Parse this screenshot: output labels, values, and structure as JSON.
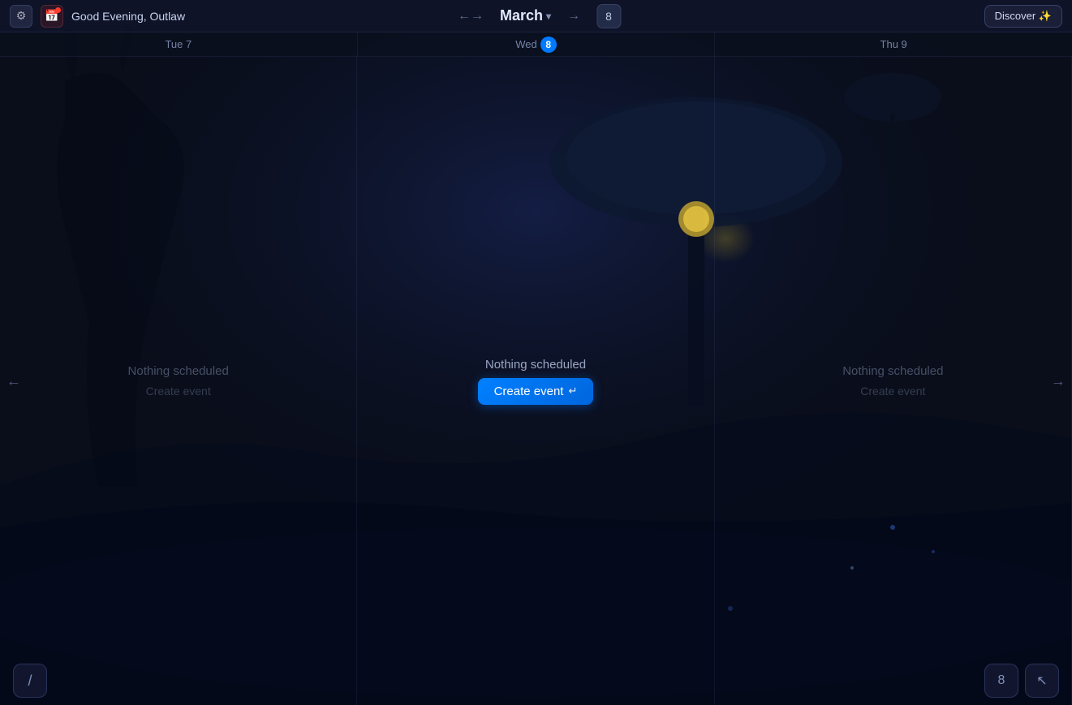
{
  "header": {
    "greeting": "Good Evening, Outlaw",
    "month": "March",
    "chevron": "▾",
    "day_number": "8",
    "discover_label": "Discover ✨",
    "nav_left": "←",
    "nav_right": "→"
  },
  "day_headers": [
    {
      "label": "Tue 7",
      "is_today": false,
      "today_num": null
    },
    {
      "label": "Wed",
      "is_today": true,
      "today_num": "8"
    },
    {
      "label": "Thu 9",
      "is_today": false,
      "today_num": null
    }
  ],
  "columns": [
    {
      "id": "tue7",
      "nothing_scheduled": "Nothing scheduled",
      "create_event": "Create event",
      "is_today": false
    },
    {
      "id": "wed8",
      "nothing_scheduled": "Nothing scheduled",
      "create_event": "Create event",
      "is_today": true
    },
    {
      "id": "thu9",
      "nothing_scheduled": "Nothing scheduled",
      "create_event": "Create event",
      "is_today": false
    }
  ],
  "bottom": {
    "slash_label": "/",
    "today_num": "8",
    "cursor_icon": "↖"
  },
  "icons": {
    "gear": "⚙",
    "calendar": "📅",
    "left_arrow": "←",
    "right_arrow": "→",
    "return": "↵"
  }
}
